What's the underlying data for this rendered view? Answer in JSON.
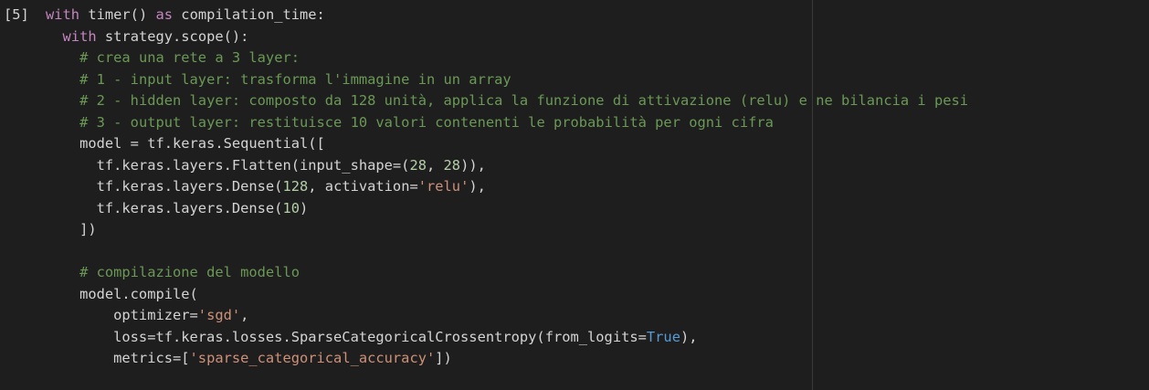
{
  "cell": {
    "prompt": "[5]",
    "lines": [
      [
        {
          "t": "kw",
          "v": "with"
        },
        {
          "t": "tx",
          "v": " timer() "
        },
        {
          "t": "kw",
          "v": "as"
        },
        {
          "t": "tx",
          "v": " compilation_time:"
        }
      ],
      [
        {
          "t": "tx",
          "v": "  "
        },
        {
          "t": "kw",
          "v": "with"
        },
        {
          "t": "tx",
          "v": " strategy.scope():"
        }
      ],
      [
        {
          "t": "tx",
          "v": "    "
        },
        {
          "t": "cm",
          "v": "# crea una rete a 3 layer:"
        }
      ],
      [
        {
          "t": "tx",
          "v": "    "
        },
        {
          "t": "cm",
          "v": "# 1 - input layer: trasforma l'immagine in un array"
        }
      ],
      [
        {
          "t": "tx",
          "v": "    "
        },
        {
          "t": "cm",
          "v": "# 2 - hidden layer: composto da 128 unità, applica la funzione di attivazione (relu) e ne bilancia i pesi"
        }
      ],
      [
        {
          "t": "tx",
          "v": "    "
        },
        {
          "t": "cm",
          "v": "# 3 - output layer: restituisce 10 valori contenenti le probabilità per ogni cifra"
        }
      ],
      [
        {
          "t": "tx",
          "v": "    model = tf.keras.Sequential(["
        }
      ],
      [
        {
          "t": "tx",
          "v": "      tf.keras.layers.Flatten(input_shape=("
        },
        {
          "t": "num",
          "v": "28"
        },
        {
          "t": "tx",
          "v": ", "
        },
        {
          "t": "num",
          "v": "28"
        },
        {
          "t": "tx",
          "v": ")),"
        }
      ],
      [
        {
          "t": "tx",
          "v": "      tf.keras.layers.Dense("
        },
        {
          "t": "num",
          "v": "128"
        },
        {
          "t": "tx",
          "v": ", activation="
        },
        {
          "t": "str",
          "v": "'relu'"
        },
        {
          "t": "tx",
          "v": "),"
        }
      ],
      [
        {
          "t": "tx",
          "v": "      tf.keras.layers.Dense("
        },
        {
          "t": "num",
          "v": "10"
        },
        {
          "t": "tx",
          "v": ")"
        }
      ],
      [
        {
          "t": "tx",
          "v": "    ])"
        }
      ],
      [
        {
          "t": "tx",
          "v": ""
        }
      ],
      [
        {
          "t": "tx",
          "v": "    "
        },
        {
          "t": "cm",
          "v": "# compilazione del modello"
        }
      ],
      [
        {
          "t": "tx",
          "v": "    model.compile("
        }
      ],
      [
        {
          "t": "tx",
          "v": "        optimizer="
        },
        {
          "t": "str",
          "v": "'sgd'"
        },
        {
          "t": "tx",
          "v": ","
        }
      ],
      [
        {
          "t": "tx",
          "v": "        loss=tf.keras.losses.SparseCategoricalCrossentropy(from_logits="
        },
        {
          "t": "bi",
          "v": "True"
        },
        {
          "t": "tx",
          "v": "),"
        }
      ],
      [
        {
          "t": "tx",
          "v": "        metrics=["
        },
        {
          "t": "str",
          "v": "'sparse_categorical_accuracy'"
        },
        {
          "t": "tx",
          "v": "])"
        }
      ]
    ]
  },
  "colors": {
    "background": "#1e1e1e",
    "text": "#d4d4d4",
    "keyword": "#c586c0",
    "comment": "#6a9955",
    "string": "#ce9178",
    "number": "#b5cea8",
    "builtin": "#569cd6"
  }
}
